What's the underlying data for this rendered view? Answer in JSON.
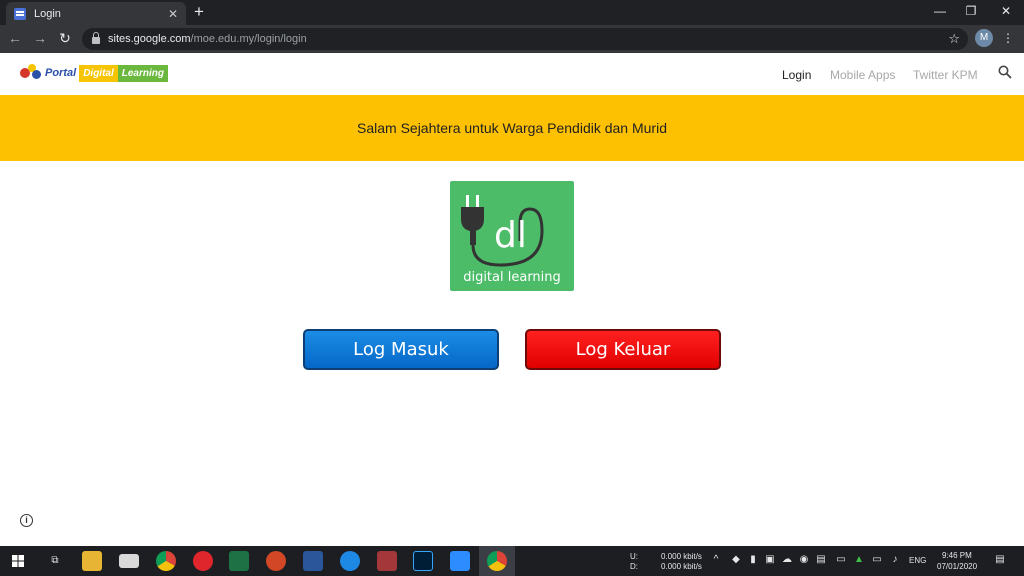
{
  "browser": {
    "tab_title": "Login",
    "tab_close": "✕",
    "new_tab": "+",
    "url_host": "sites.google.com",
    "url_path": "/moe.edu.my/login/login",
    "profile_initial": "M"
  },
  "site": {
    "logo_portal": "Portal",
    "logo_digital": "Digital",
    "logo_learning": "Learning",
    "nav": [
      {
        "label": "Login"
      },
      {
        "label": "Mobile Apps"
      },
      {
        "label": "Twitter KPM"
      }
    ],
    "banner_text": "Salam Sejahtera untuk Warga Pendidik dan Murid",
    "main_logo_text": "digital learning",
    "main_logo_letters": "dl",
    "buttons": {
      "login": "Log Masuk",
      "logout": "Log Keluar"
    },
    "info_symbol": "i"
  },
  "taskbar": {
    "net_up_label": "U:",
    "net_down_label": "D:",
    "net_up": "0.000 kbit/s",
    "net_down": "0.000 kbit/s",
    "lang": "ENG",
    "time": "9:46 PM",
    "date": "07/01/2020"
  },
  "colors": {
    "banner": "#fec102",
    "login_button": "#0a77d8",
    "logout_button": "#f20000",
    "logo_green": "#4cbc69"
  }
}
